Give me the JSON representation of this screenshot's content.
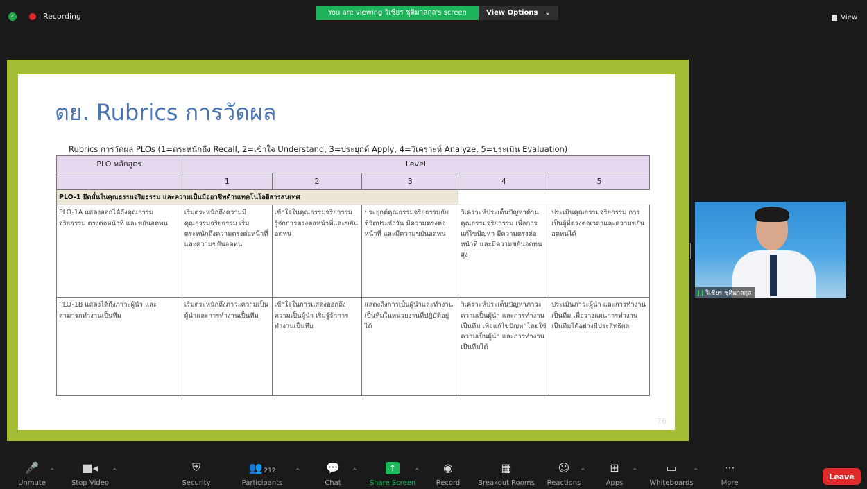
{
  "top_bar": {
    "recording_label": "Recording",
    "viewing_banner": "You are viewing วิเชียร ชุติมาสกุล's screen",
    "view_options_label": "View Options",
    "view_label": "View"
  },
  "slide": {
    "title": "ตย. Rubrics การวัดผล",
    "caption": "Rubrics การวัดผล PLOs (1=ตระหนักถึง Recall, 2=เข้าใจ Understand, 3=ประยุกต์ Apply, 4=วิเคราะห์ Analyze, 5=ประเมิน Evaluation)",
    "page_number": "76",
    "table": {
      "plo_header": "PLO หลักสูตร",
      "level_header": "Level",
      "levels": [
        "1",
        "2",
        "3",
        "4",
        "5"
      ],
      "group_label": "PLO-1 ยึดมั่นในคุณธรรมจริยธรรม และความเป็นมืออาชีพด้านเทคโนโลยีสารสนเทศ",
      "rows": [
        {
          "plo": "PLO-1A แสดงออกได้ถึงคุณธรรมจริยธรรม ตรงต่อหน้าที่ และขยันอดทน",
          "cells": [
            "เริ่มตระหนักถึงความมีคุณธรรมจริยธรรม เริ่มตระหนักถึงความตรงต่อหน้าที่และความขยันอดทน",
            "เข้าใจในคุณธรรมจริยธรรม รู้จักการตรงต่อหน้าที่และขยันอดทน",
            "ประยุกต์คุณธรรมจริยธรรมกับชีวิตประจำวัน มีความตรงต่อหน้าที่ และมีความขยันอดทน",
            "วิเคราะห์ประเด็นปัญหาด้านคุณธรรมจริยธรรม เพื่อการแก้ไขปัญหา มีความตรงต่อหน้าที่ และมีความขยันอดทนสูง",
            "ประเมินคุณธรรมจริยธรรม การเป็นผู้ที่ตรงต่อเวลาและความขยันอดทนได้"
          ]
        },
        {
          "plo": "PLO-1B แสดงได้ถึงภาวะผู้นำ และสามารถทำงานเป็นทีม",
          "cells": [
            "เริ่มตระหนักถึงภาวะความเป็นผู้นำและการทำงานเป็นทีม",
            "เข้าใจในการแสดงออกถึงความเป็นผู้นำ เริ่มรู้จักการทำงานเป็นทีม",
            "แสดงถึงการเป็นผู้นำและทำงานเป็นทีมในหน่วยงานที่ปฏิบัติอยู่ได้",
            "วิเคราะห์ประเด็นปัญหาภาวะความเป็นผู้นำ และการทำงานเป็นทีม เพื่อแก้ไขปัญหาโดยใช้ความเป็นผู้นำ และการทำงานเป็นทีมได้",
            "ประเมินภาวะผู้นำ และการทำงานเป็นทีม เพื่อวางแผนการทำงานเป็นทีมได้อย่างมีประสิทธิผล"
          ]
        }
      ]
    }
  },
  "webcam": {
    "name": "วิเชียร ชุติมาสกุล"
  },
  "toolbar": {
    "unmute": "Unmute",
    "stop_video": "Stop Video",
    "security": "Security",
    "participants": "Participants",
    "participants_count": "212",
    "chat": "Chat",
    "share_screen": "Share Screen",
    "record": "Record",
    "breakout_rooms": "Breakout Rooms",
    "reactions": "Reactions",
    "apps": "Apps",
    "whiteboards": "Whiteboards",
    "more": "More",
    "leave": "Leave"
  },
  "colors": {
    "share_border": "#a4be34",
    "title_blue": "#4a74b0",
    "header_purple": "#e6d8ef",
    "band_beige": "#ece6d7",
    "zoom_green": "#1cb35a",
    "leave_red": "#df2b2b"
  }
}
